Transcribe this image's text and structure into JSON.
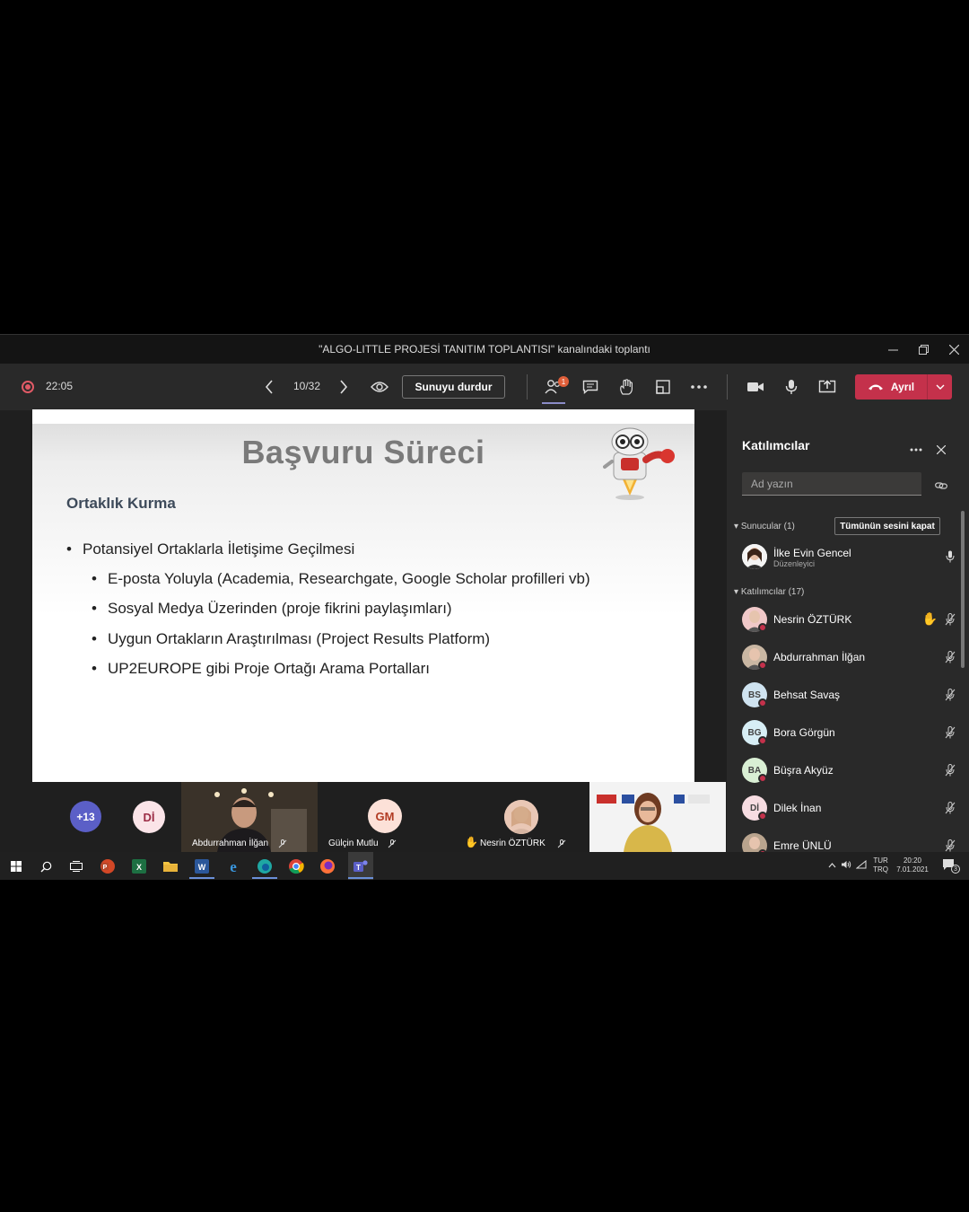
{
  "window": {
    "title": "\"ALGO-LITTLE PROJESİ TANITIM TOPLANTISI\" kanalındaki toplantı"
  },
  "toolbar": {
    "timer": "22:05",
    "page_counter": "10/32",
    "stop_presenting_label": "Sunuyu durdur",
    "people_badge": "1",
    "leave_label": "Ayrıl"
  },
  "slide": {
    "title": "Başvuru Süreci",
    "subtitle": "Ortaklık Kurma",
    "bullet_main": "Potansiyel Ortaklarla İletişime Geçilmesi",
    "sub_bullets": [
      "E-posta Yoluyla (Academia, Researchgate, Google Scholar profilleri vb)",
      "Sosyal Medya Üzerinden (proje fikrini paylaşımları)",
      "Uygun Ortakların Araştırılması (Project Results Platform)",
      "UP2EUROPE gibi Proje Ortağı Arama Portalları"
    ]
  },
  "video_strip": {
    "more_count": "+13",
    "tile_di": "Dİ",
    "tile_abdurrahman": "Abdurrahman İlğan",
    "tile_gm_initials": "GM",
    "tile_gulcin": "Gülçin Mutlu",
    "tile_nesrin": "Nesrin ÖZTÜRK"
  },
  "panel": {
    "title": "Katılımcılar",
    "search_placeholder": "Ad yazın",
    "presenters_label": "Sunucular (1)",
    "mute_all_label": "Tümünün sesini kapat",
    "attendees_label": "Katılımcılar (17)",
    "presenter": {
      "name": "İlke Evin Gencel",
      "role": "Düzenleyici"
    },
    "participants": [
      {
        "name": "Nesrin ÖZTÜRK",
        "initials": "",
        "color": "#f0c8c8",
        "hand": true
      },
      {
        "name": "Abdurrahman İlğan",
        "initials": "",
        "color": "#c9b7a3",
        "hand": false
      },
      {
        "name": "Behsat Savaş",
        "initials": "BS",
        "color": "#cfe3f0",
        "hand": false
      },
      {
        "name": "Bora Görgün",
        "initials": "BG",
        "color": "#d7eef5",
        "hand": false
      },
      {
        "name": "Büşra Akyüz",
        "initials": "BA",
        "color": "#d9efd4",
        "hand": false
      },
      {
        "name": "Dilek İnan",
        "initials": "Dİ",
        "color": "#f7dde2",
        "hand": false
      },
      {
        "name": "Emre ÜNLÜ",
        "initials": "",
        "color": "#b9a48e",
        "hand": false
      }
    ]
  },
  "tray": {
    "lang_top": "TUR",
    "lang_bottom": "TRQ",
    "time": "20:20",
    "date": "7.01.2021",
    "notif_count": "3"
  },
  "colors": {
    "leave": "#c4314b",
    "badge": "#e05f3a",
    "accent": "#8b8cc7",
    "recording": "#e05a66"
  }
}
